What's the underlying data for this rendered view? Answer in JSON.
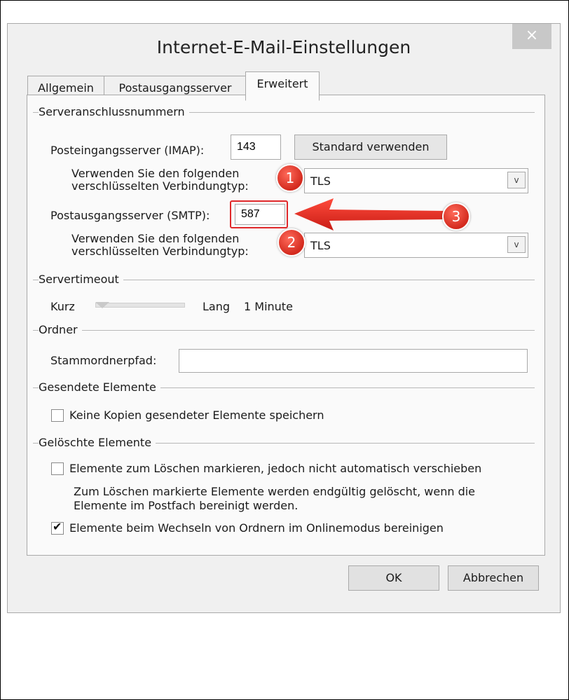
{
  "window": {
    "title": "Internet-E-Mail-Einstellungen",
    "close": "×"
  },
  "tabs": [
    {
      "label": "Allgemein"
    },
    {
      "label": "Postausgangsserver"
    },
    {
      "label": "Erweitert"
    }
  ],
  "server_ports": {
    "legend": "Serveranschlussnummern",
    "imap_label": "Posteingangsserver (IMAP):",
    "imap_value": "143",
    "default_button": "Standard verwenden",
    "enc_label_line1": "Verwenden Sie den folgenden",
    "enc_label_line2": "verschlüsselten Verbindungtyp:",
    "imap_encryption": "TLS",
    "smtp_label": "Postausgangsserver (SMTP):",
    "smtp_value": "587",
    "smtp_encryption": "TLS"
  },
  "timeout": {
    "legend": "Servertimeout",
    "short": "Kurz",
    "long": "Lang",
    "value": "1 Minute",
    "slider_fraction": 0.0
  },
  "folders": {
    "legend": "Ordner",
    "root_label": "Stammordnerpfad:",
    "root_value": ""
  },
  "sent": {
    "legend": "Gesendete Elemente",
    "no_copies": "Keine Kopien gesendeter Elemente speichern",
    "no_copies_checked": false
  },
  "deleted": {
    "legend": "Gelöschte Elemente",
    "mark_delete": "Elemente zum Löschen markieren, jedoch nicht automatisch verschieben",
    "mark_delete_checked": false,
    "note_line1": "Zum Löschen markierte Elemente werden endgültig gelöscht, wenn die",
    "note_line2": "Elemente im Postfach bereinigt werden.",
    "purge": "Elemente beim Wechseln von Ordnern im Onlinemodus bereinigen",
    "purge_checked": true
  },
  "buttons": {
    "ok": "OK",
    "cancel": "Abbrechen"
  },
  "annotations": {
    "badge1": "1",
    "badge2": "2",
    "badge3": "3",
    "check_mark": "✔",
    "dropdown_arrow": "v"
  },
  "colors": {
    "annotation": "#e0282a",
    "dialog_bg": "#f0f0f0",
    "panel_bg": "#fafafa"
  }
}
